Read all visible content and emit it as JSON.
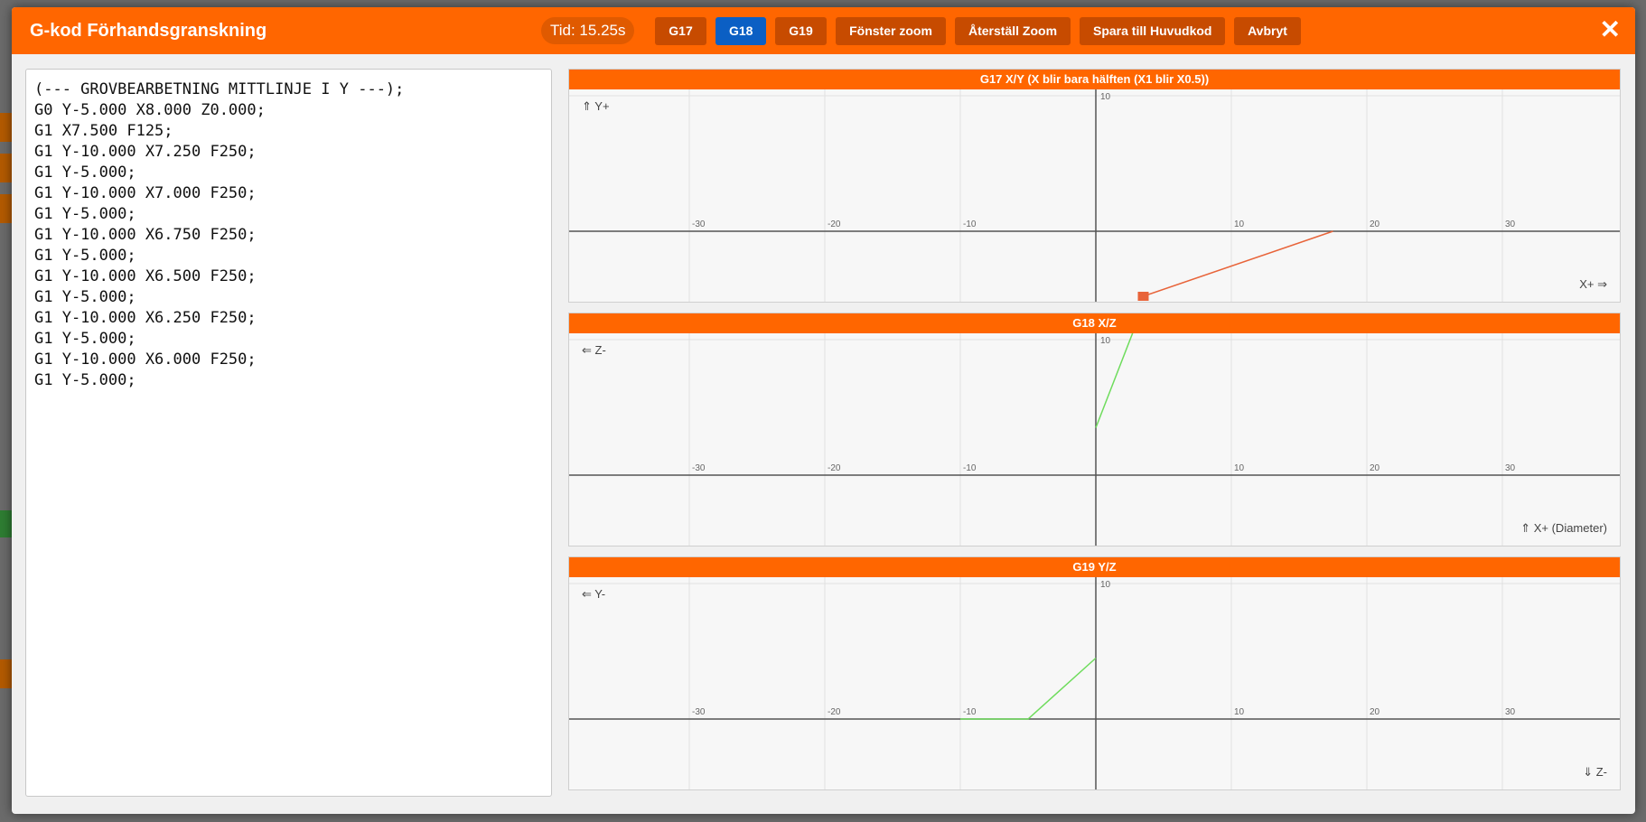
{
  "header": {
    "title": "G-kod Förhandsgranskning",
    "time": "Tid: 15.25s",
    "buttons": {
      "g17": "G17",
      "g18": "G18",
      "g19": "G19",
      "window_zoom": "Fönster zoom",
      "reset_zoom": "Återställ Zoom",
      "save_main": "Spara till Huvudkod",
      "cancel": "Avbryt"
    },
    "active_plane": "G18",
    "close_icon": "close-icon"
  },
  "code": [
    "(--- GROVBEARBETNING MITTLINJE I Y ---);",
    "G0 Y-5.000 X8.000 Z0.000;",
    "G1 X7.500 F125;",
    "G1 Y-10.000 X7.250 F250;",
    "G1 Y-5.000;",
    "G1 Y-10.000 X7.000 F250;",
    "G1 Y-5.000;",
    "G1 Y-10.000 X6.750 F250;",
    "G1 Y-5.000;",
    "G1 Y-10.000 X6.500 F250;",
    "G1 Y-5.000;",
    "G1 Y-10.000 X6.250 F250;",
    "G1 Y-5.000;",
    "G1 Y-10.000 X6.000 F250;",
    "G1 Y-5.000;"
  ],
  "colors": {
    "accent": "#ff6600",
    "active": "#0b5fc4",
    "path_xy": "#e8643a",
    "path_green": "#6edc5c"
  },
  "panels": [
    {
      "title": "G17 X/Y (X blir bara hälften (X1 blir X0.5))",
      "vertical_label": "⇑ Y+",
      "horizontal_label": "X+ ⇒",
      "y_tick": "10",
      "x_ticks": [
        "-30",
        "-20",
        "-10",
        "10",
        "20",
        "30"
      ],
      "path": [
        [
          3.5,
          -4.8
        ],
        [
          17.5,
          0
        ]
      ],
      "path_color": "#e8643a"
    },
    {
      "title": "G18 X/Z",
      "vertical_label": "⇐ Z-",
      "horizontal_label": "⇑ X+ (Diameter)",
      "y_tick": "10",
      "x_ticks": [
        "-30",
        "-20",
        "-10",
        "10",
        "20",
        "30"
      ],
      "path": [
        [
          0,
          3.5
        ],
        [
          2.8,
          10.7
        ]
      ],
      "path_color": "#6edc5c"
    },
    {
      "title": "G19 Y/Z",
      "vertical_label": "⇐ Y-",
      "horizontal_label": "⇓ Z-",
      "y_tick": "10",
      "x_ticks": [
        "-30",
        "-20",
        "-10",
        "10",
        "20",
        "30"
      ],
      "path": [
        [
          -10,
          0
        ],
        [
          -5,
          0
        ],
        [
          0,
          4.5
        ]
      ],
      "path_color": "#6edc5c"
    }
  ]
}
